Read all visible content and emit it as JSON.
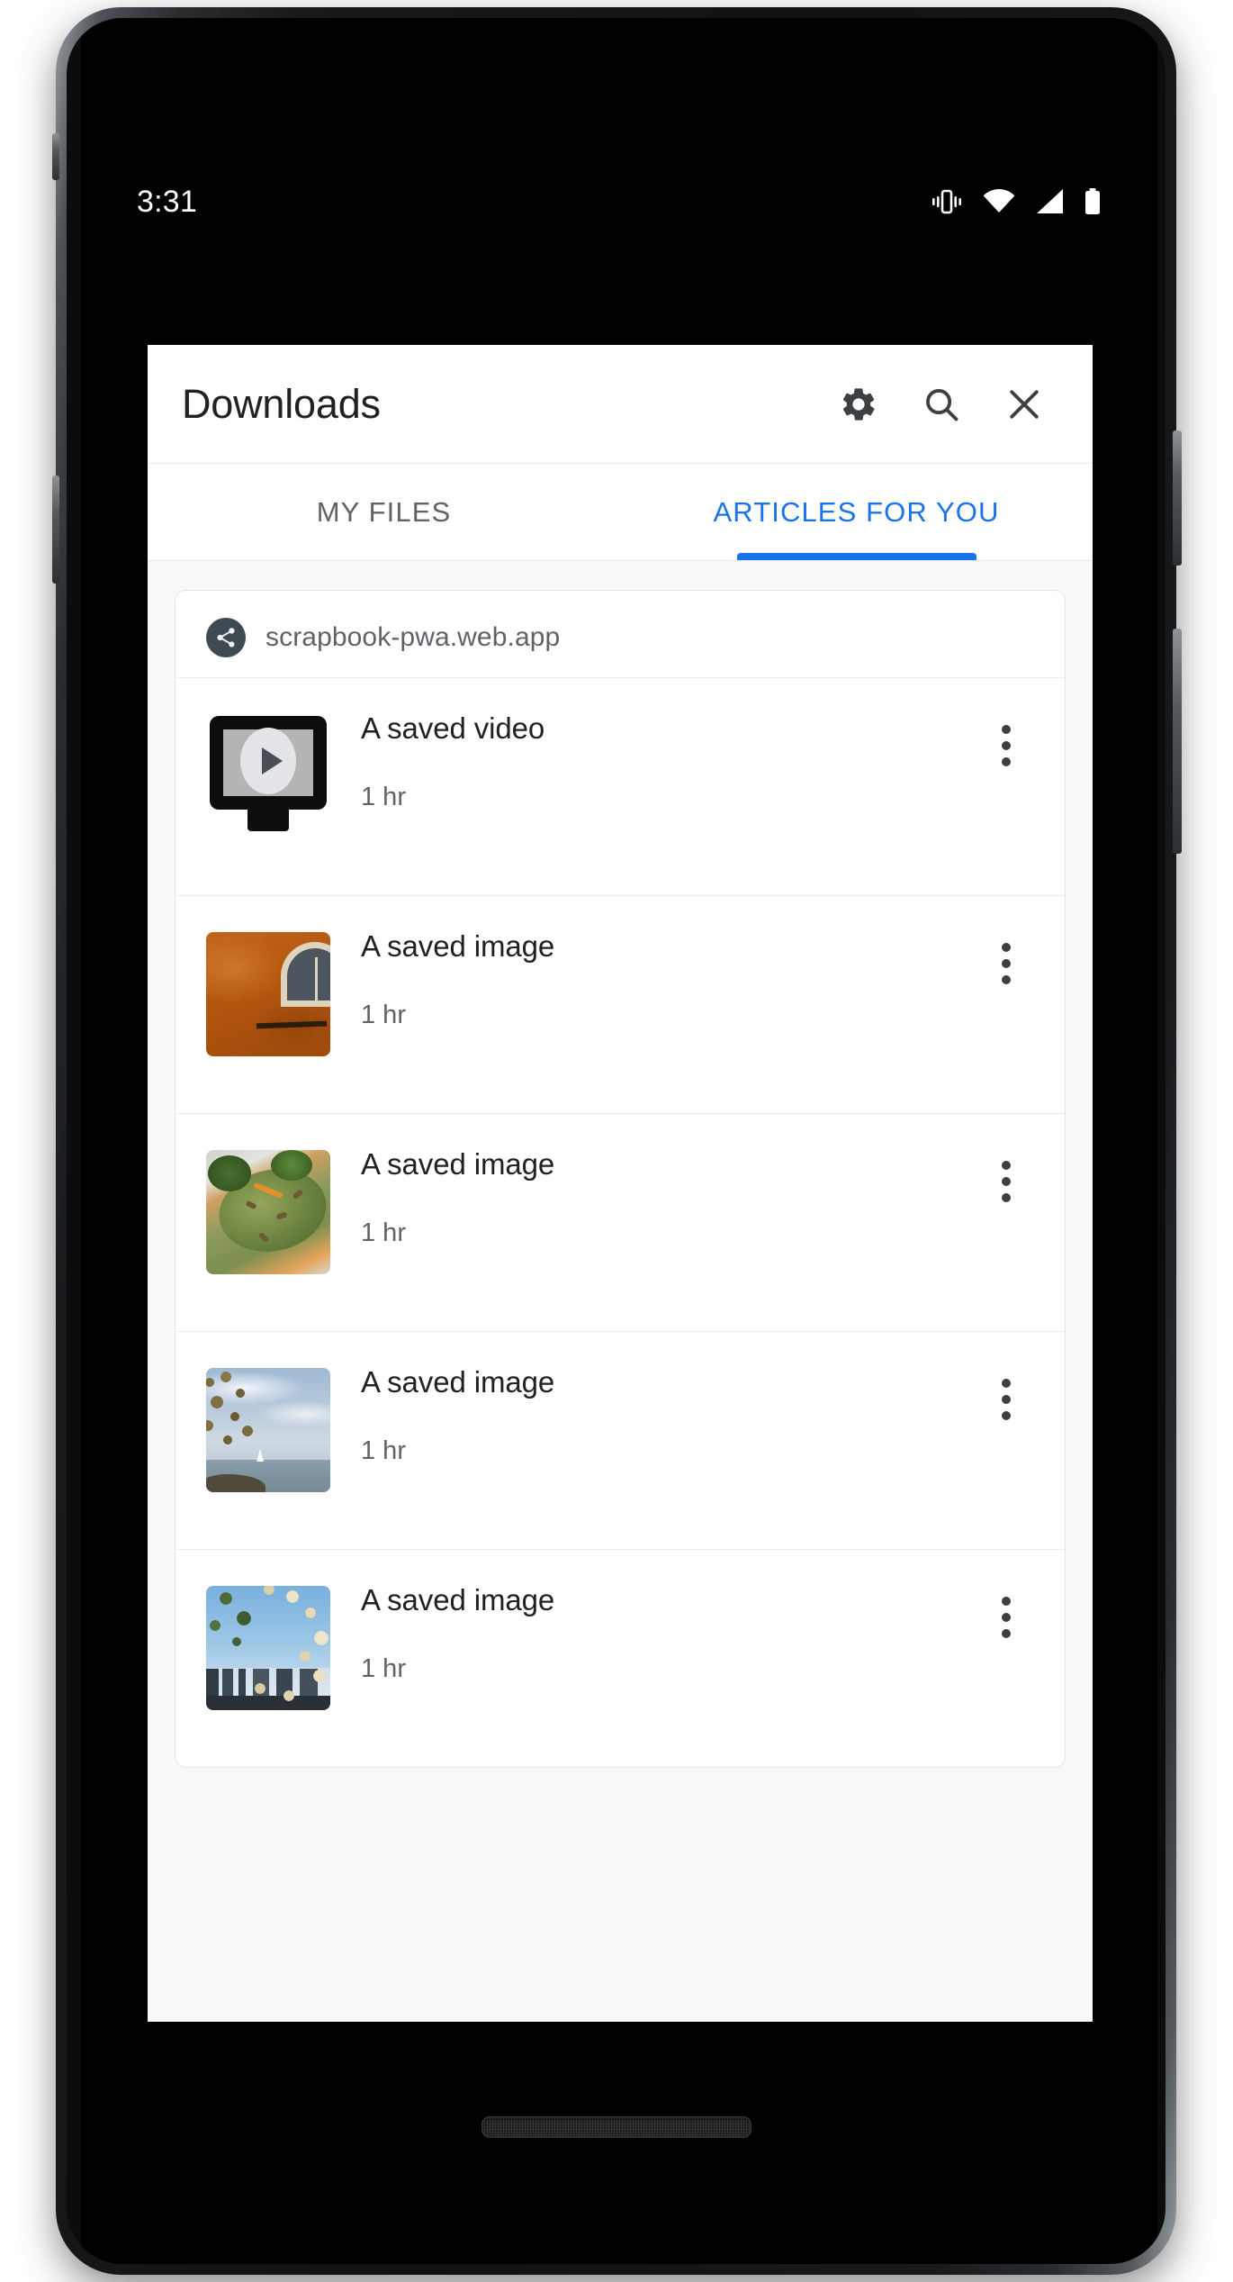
{
  "status_bar": {
    "time": "3:31",
    "icons": [
      "vibrate-icon",
      "wifi-icon",
      "cellular-signal-icon",
      "battery-icon"
    ]
  },
  "app_bar": {
    "title": "Downloads",
    "actions": [
      {
        "name": "settings-button",
        "icon": "gear-icon"
      },
      {
        "name": "search-button",
        "icon": "search-icon"
      },
      {
        "name": "close-button",
        "icon": "close-icon"
      }
    ]
  },
  "tabs": [
    {
      "label": "MY FILES",
      "active": false
    },
    {
      "label": "ARTICLES FOR YOU",
      "active": true
    }
  ],
  "card": {
    "source": {
      "icon": "share-icon",
      "label": "scrapbook-pwa.web.app"
    },
    "items": [
      {
        "title": "A saved video",
        "time": "1 hr",
        "thumb": "video-placeholder-icon",
        "menu": "overflow-menu-icon"
      },
      {
        "title": "A saved image",
        "time": "1 hr",
        "thumb": "orange-wall-photo",
        "menu": "overflow-menu-icon"
      },
      {
        "title": "A saved image",
        "time": "1 hr",
        "thumb": "avocado-toast-photo",
        "menu": "overflow-menu-icon"
      },
      {
        "title": "A saved image",
        "time": "1 hr",
        "thumb": "lake-shoreline-photo",
        "menu": "overflow-menu-icon"
      },
      {
        "title": "A saved image",
        "time": "1 hr",
        "thumb": "city-skyline-blossom-photo",
        "menu": "overflow-menu-icon"
      }
    ]
  },
  "colors": {
    "accent_blue": "#1a73e8",
    "text_primary": "#202124",
    "text_secondary": "#5f6368",
    "surface": "#ffffff",
    "background": "#f8f9fa",
    "avatar": "#3d4a52"
  }
}
